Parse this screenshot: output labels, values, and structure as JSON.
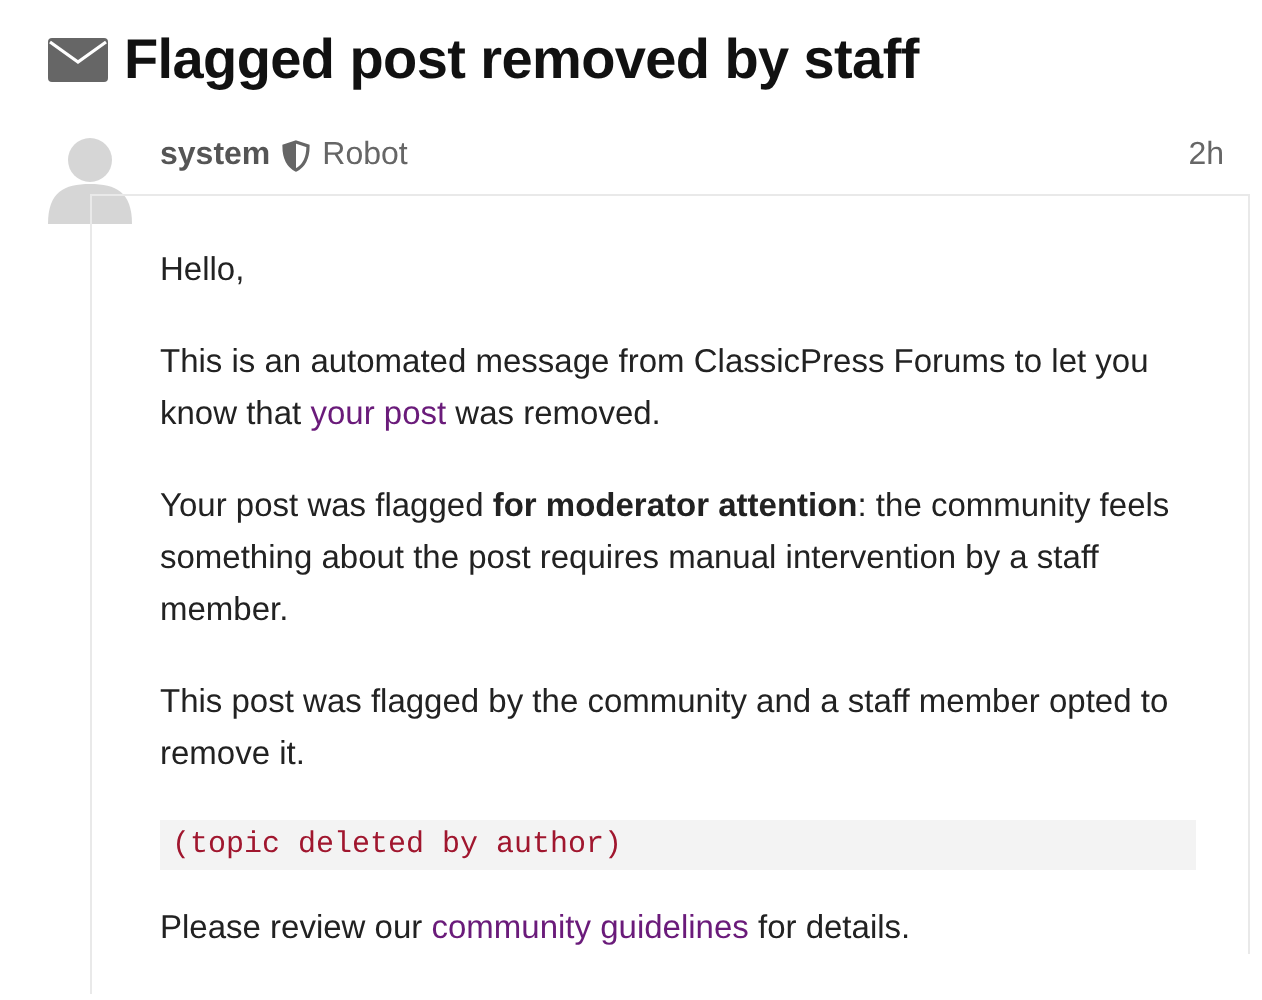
{
  "topic": {
    "title": "Flagged post removed by staff"
  },
  "post": {
    "username": "system",
    "user_title": "Robot",
    "time": "2h",
    "body": [
      {
        "kind": "paragraph",
        "parts": [
          {
            "kind": "text",
            "text": "Hello,"
          }
        ]
      },
      {
        "kind": "paragraph",
        "parts": [
          {
            "kind": "text",
            "text": "This is an automated message from ClassicPress Forums to let you know that "
          },
          {
            "kind": "link",
            "text": "your post"
          },
          {
            "kind": "text",
            "text": " was removed."
          }
        ]
      },
      {
        "kind": "paragraph",
        "parts": [
          {
            "kind": "text",
            "text": "Your post was flagged **for moderator attention**: the community feels something about the post requires manual intervention by a staff member."
          }
        ]
      },
      {
        "kind": "paragraph",
        "parts": [
          {
            "kind": "text",
            "text": "This post was flagged by the community and a staff member opted to remove it."
          }
        ]
      },
      {
        "kind": "code",
        "parts": [
          {
            "kind": "text",
            "text": "(topic deleted by author)"
          }
        ]
      },
      {
        "kind": "paragraph",
        "parts": [
          {
            "kind": "text",
            "text": "Please review our "
          },
          {
            "kind": "link",
            "text": "community guidelines"
          },
          {
            "kind": "text",
            "text": " for details."
          }
        ]
      }
    ]
  }
}
